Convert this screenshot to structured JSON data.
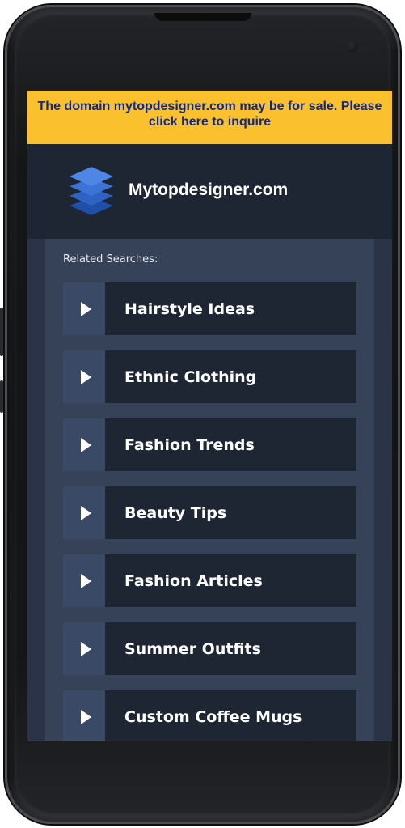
{
  "banner": {
    "text": "The domain mytopdesigner.com may be for sale. Please click here to inquire"
  },
  "header": {
    "site_name": "Mytopdesigner.com",
    "logo_icon": "stacked-layers-icon"
  },
  "related": {
    "label": "Related Searches:",
    "items": [
      {
        "label": "Hairstyle Ideas"
      },
      {
        "label": "Ethnic Clothing"
      },
      {
        "label": "Fashion Trends"
      },
      {
        "label": "Beauty Tips"
      },
      {
        "label": "Fashion Articles"
      },
      {
        "label": "Summer Outfits"
      },
      {
        "label": "Custom Coffee Mugs"
      }
    ]
  },
  "colors": {
    "banner_bg": "#fbc02d",
    "banner_text": "#0d2a8a",
    "header_bg": "#1e2633",
    "item_bg": "#1e2633",
    "arrow_bg": "#3a4a66",
    "panel_bg": "#354257"
  }
}
